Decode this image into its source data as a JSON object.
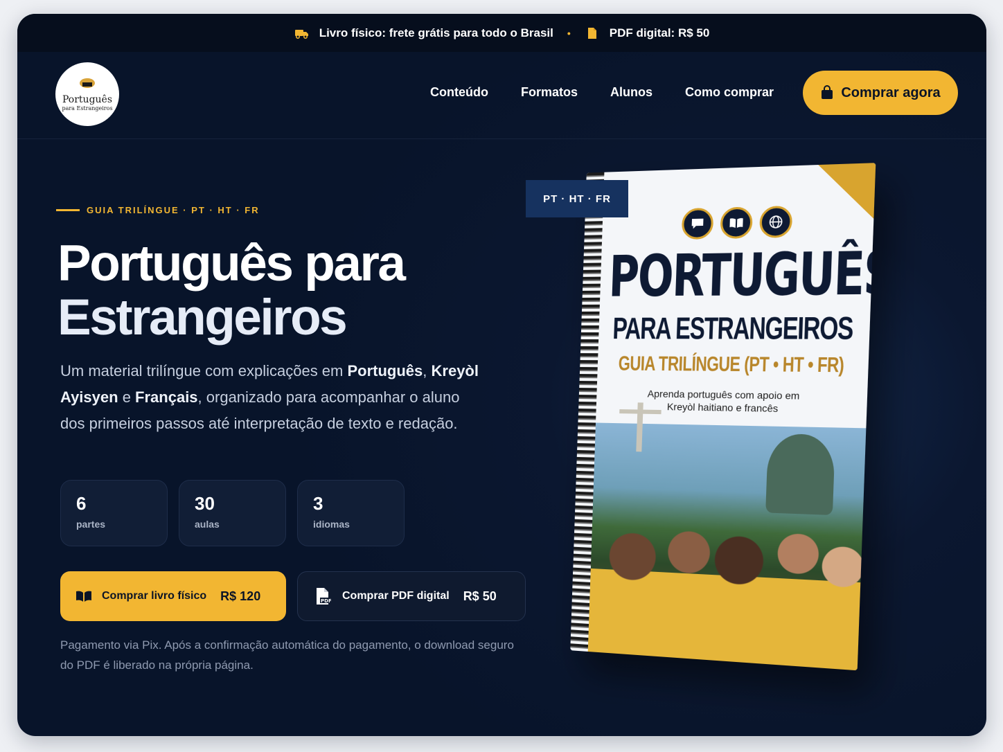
{
  "topbar": {
    "shipping": "Livro físico: frete grátis para todo o Brasil",
    "separator": "•",
    "pdf": "PDF digital: R$ 50"
  },
  "logo": {
    "line1": "Português",
    "line2": "para Estrangeiros"
  },
  "nav": {
    "items": [
      {
        "label": "Conteúdo"
      },
      {
        "label": "Formatos"
      },
      {
        "label": "Alunos"
      },
      {
        "label": "Como comprar"
      }
    ],
    "cta_label": "Comprar agora"
  },
  "hero": {
    "eyebrow": "GUIA TRILÍNGUE · PT · HT · FR",
    "title_line1": "Português para",
    "title_line2": "Estrangeiros",
    "desc": {
      "intro": "Um material trilíngue com explicações em ",
      "lang1": "Português",
      "sep1": ", ",
      "lang2": "Kreyòl Ayisyen",
      "sep2": " e ",
      "lang3": "Français",
      "outro": ", organizado para acompanhar o aluno dos primeiros passos até interpretação de texto e redação."
    },
    "stats": [
      {
        "num": "6",
        "label": "partes"
      },
      {
        "num": "30",
        "label": "aulas"
      },
      {
        "num": "3",
        "label": "idiomas"
      }
    ],
    "buy_physical": {
      "label": "Comprar livro físico",
      "price": "R$ 120"
    },
    "buy_pdf": {
      "label": "Comprar PDF digital",
      "price": "R$ 50"
    },
    "note": "Pagamento via Pix. Após a confirmação automática do pagamento, o download seguro do PDF é liberado na própria página."
  },
  "book": {
    "badge": "PT · HT · FR",
    "title1": "PORTUGUÊS",
    "title2": "PARA ESTRANGEIROS",
    "title3": "GUIA TRILÍNGUE (PT • HT • FR)",
    "subtitle": "Aprenda português com apoio em Kreyòl haitiano e francês"
  },
  "colors": {
    "accent": "#f2b632",
    "background": "#08142a",
    "badge": "#16325f"
  },
  "icons": [
    "truck-icon",
    "pdf-file-icon",
    "shopping-bag-icon",
    "book-open-icon"
  ]
}
